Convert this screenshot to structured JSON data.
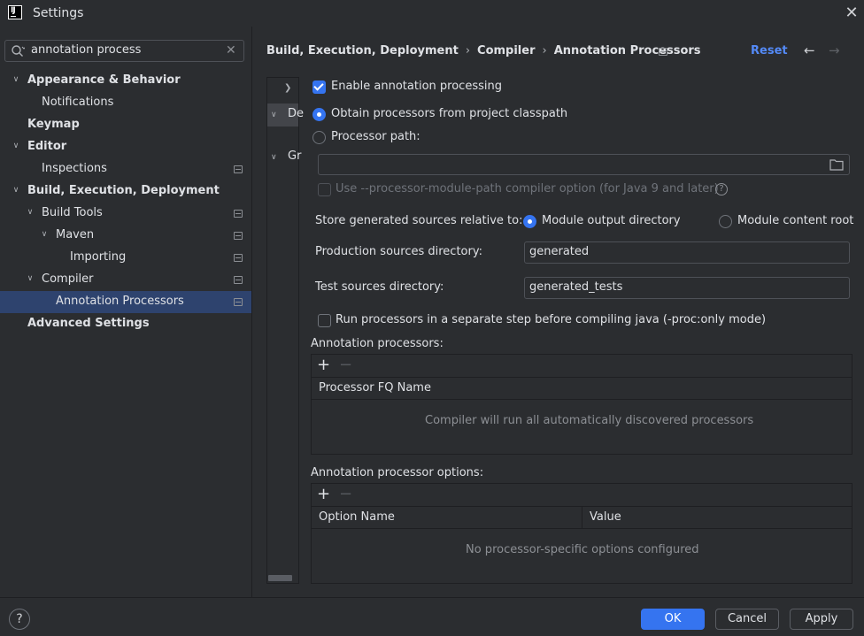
{
  "window": {
    "title": "Settings",
    "close_icon": "close-icon",
    "logo_text": "IJ"
  },
  "search": {
    "value": "annotation process",
    "icon": "search-icon",
    "clear_icon": "close-icon"
  },
  "sidebar": {
    "items": [
      {
        "label": "Appearance & Behavior",
        "expanded": true
      },
      {
        "label": "Notifications"
      },
      {
        "label": "Keymap"
      },
      {
        "label": "Editor",
        "expanded": true
      },
      {
        "label": "Inspections"
      },
      {
        "label": "Build, Execution, Deployment",
        "expanded": true
      },
      {
        "label": "Build Tools",
        "expanded": true
      },
      {
        "label": "Maven",
        "expanded": true
      },
      {
        "label": "Importing"
      },
      {
        "label": "Compiler",
        "expanded": true
      },
      {
        "label": "Annotation Processors",
        "selected": true
      },
      {
        "label": "Advanced Settings"
      }
    ]
  },
  "breadcrumb": {
    "items": [
      "Build, Execution, Deployment",
      "Compiler",
      "Annotation Processors"
    ],
    "separator": "›"
  },
  "header": {
    "reset": "Reset",
    "back_icon": "arrow-left-icon",
    "forward_icon": "arrow-right-icon"
  },
  "profiles_panel": {
    "item1": "De",
    "item2": "Gr"
  },
  "form": {
    "enable_processing": {
      "label": "Enable annotation processing",
      "checked": true
    },
    "obtain_classpath": {
      "label": "Obtain processors from project classpath",
      "selected": true
    },
    "processor_path": {
      "label": "Processor path:",
      "selected": false,
      "value": ""
    },
    "module_path_option": {
      "label": "Use --processor-module-path compiler option (for Java 9 and later)",
      "checked": false,
      "enabled": false
    },
    "store_generated": {
      "label": "Store generated sources relative to:",
      "options": [
        "Module output directory",
        "Module content root"
      ],
      "selected": "Module output directory"
    },
    "production_dir": {
      "label": "Production sources directory:",
      "value": "generated"
    },
    "test_dir": {
      "label": "Test sources directory:",
      "value": "generated_tests"
    },
    "separate_step": {
      "label": "Run processors in a separate step before compiling java (-proc:only mode)",
      "checked": false
    }
  },
  "processors_table": {
    "title": "Annotation processors:",
    "add_label": "+",
    "remove_label": "−",
    "columns": [
      "Processor FQ Name"
    ],
    "empty_text": "Compiler will run all automatically discovered processors"
  },
  "options_table": {
    "title": "Annotation processor options:",
    "add_label": "+",
    "remove_label": "−",
    "columns": [
      "Option Name",
      "Value"
    ],
    "empty_text": "No processor-specific options configured"
  },
  "footer": {
    "help": "?",
    "ok": "OK",
    "cancel": "Cancel",
    "apply": "Apply"
  },
  "colors": {
    "accent": "#3574f0",
    "link": "#548af7",
    "background": "#2b2d30",
    "selection": "#2e436e"
  }
}
